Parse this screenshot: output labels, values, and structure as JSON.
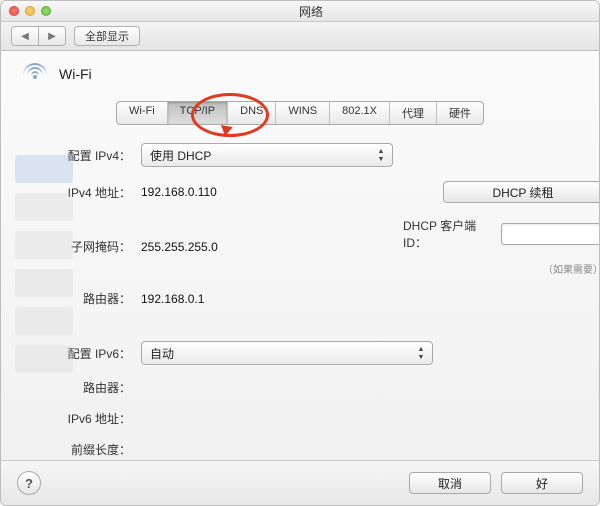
{
  "window": {
    "title": "网络"
  },
  "toolbar": {
    "show_all": "全部显示"
  },
  "header": {
    "wifi_label": "Wi-Fi"
  },
  "tabs": {
    "wifi": "Wi-Fi",
    "tcpip": "TCP/IP",
    "dns": "DNS",
    "wins": "WINS",
    "8021x": "802.1X",
    "proxy": "代理",
    "hardware": "硬件",
    "active": "tcpip"
  },
  "ipv4": {
    "configure_label": "配置 IPv4：",
    "configure_value": "使用 DHCP",
    "address_label": "IPv4 地址：",
    "address_value": "192.168.0.110",
    "subnet_label": "子网掩码：",
    "subnet_value": "255.255.255.0",
    "router_label": "路由器：",
    "router_value": "192.168.0.1"
  },
  "dhcp": {
    "renew_button": "DHCP 续租",
    "client_id_label": "DHCP 客户端 ID：",
    "client_id_value": "",
    "hint": "（如果需要）"
  },
  "ipv6": {
    "configure_label": "配置 IPv6：",
    "configure_value": "自动",
    "router_label": "路由器：",
    "router_value": "",
    "address_label": "IPv6 地址：",
    "address_value": "",
    "prefix_label": "前缀长度：",
    "prefix_value": ""
  },
  "footer": {
    "cancel": "取消",
    "ok": "好",
    "help": "?"
  }
}
